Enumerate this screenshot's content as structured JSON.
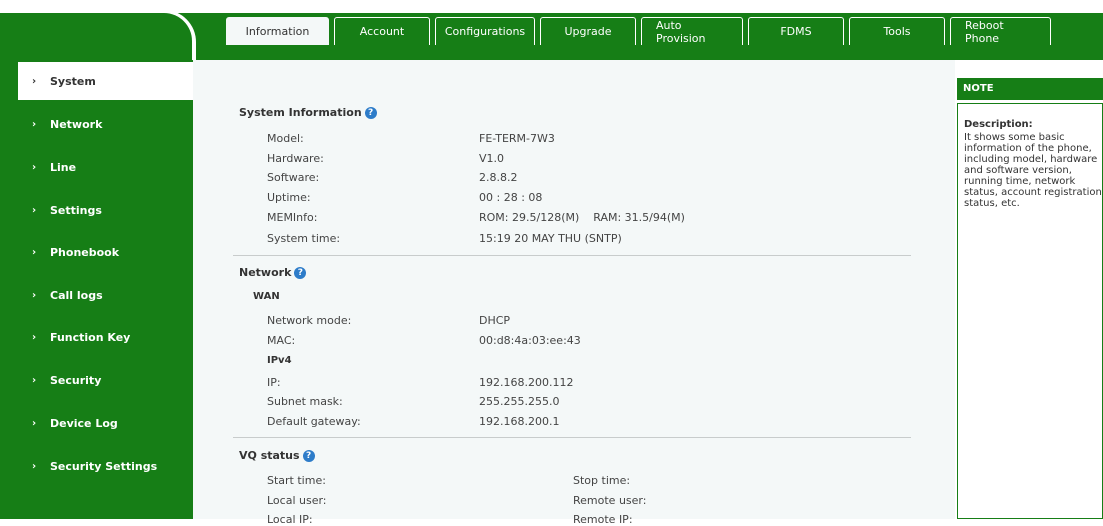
{
  "tabs": [
    {
      "label": "Information"
    },
    {
      "label": "Account"
    },
    {
      "label": "Configurations"
    },
    {
      "label": "Upgrade"
    },
    {
      "label": "Auto Provision"
    },
    {
      "label": "FDMS"
    },
    {
      "label": "Tools"
    },
    {
      "label": "Reboot Phone"
    }
  ],
  "sidebar": {
    "items": [
      {
        "label": "System"
      },
      {
        "label": "Network"
      },
      {
        "label": "Line"
      },
      {
        "label": "Settings"
      },
      {
        "label": "Phonebook"
      },
      {
        "label": "Call logs"
      },
      {
        "label": "Function Key"
      },
      {
        "label": "Security"
      },
      {
        "label": "Device Log"
      },
      {
        "label": "Security Settings"
      }
    ]
  },
  "system_info": {
    "title": "System Information",
    "rows": [
      {
        "label": "Model:",
        "value": "FE-TERM-7W3"
      },
      {
        "label": "Hardware:",
        "value": "V1.0"
      },
      {
        "label": "Software:",
        "value": "2.8.8.2"
      },
      {
        "label": "Uptime:",
        "value": "00 : 28 : 08"
      },
      {
        "label": "MEMInfo:",
        "value": "ROM: 29.5/128(M)    RAM: 31.5/94(M)"
      },
      {
        "label": "System time:",
        "value": "15:19 20 MAY THU (SNTP)"
      }
    ]
  },
  "network": {
    "title": "Network",
    "wan_title": "WAN",
    "network_mode_label": "Network mode:",
    "network_mode_value": "DHCP",
    "mac_label": "MAC:",
    "mac_value": "00:d8:4a:03:ee:43",
    "ipv4_title": "IPv4",
    "ip_label": "IP:",
    "ip_value": "192.168.200.112",
    "subnet_label": "Subnet mask:",
    "subnet_value": "255.255.255.0",
    "gateway_label": "Default gateway:",
    "gateway_value": "192.168.200.1"
  },
  "vq": {
    "title": "VQ status",
    "start_time_label": "Start time:",
    "stop_time_label": "Stop time:",
    "local_user_label": "Local user:",
    "remote_user_label": "Remote user:",
    "local_ip_label": "Local IP:",
    "remote_ip_label": "Remote IP:"
  },
  "note": {
    "title": "NOTE",
    "desc_title": "Description:",
    "desc": "It shows some basic information of the phone, including model, hardware and software version, running time, network status, account registration status, etc."
  },
  "help_glyph": "?",
  "arrow_glyph": "›",
  "colors": {
    "brand_green": "#167e16",
    "panel_bg": "#f4f8f8",
    "help_blue": "#2d7cc9"
  }
}
